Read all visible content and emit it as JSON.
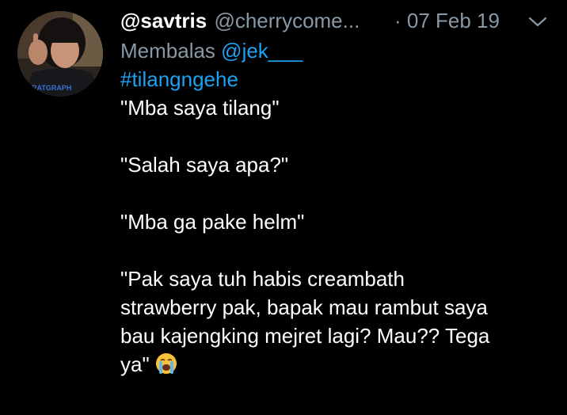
{
  "tweet": {
    "display_name": "@savtris",
    "handle": "@cherrycome...",
    "date": "· 07 Feb 19",
    "reply_prefix": "Membalas",
    "reply_mention": "@jek___",
    "hashtag": "#tilangngehe",
    "lines": [
      "\"Mba saya tilang\"",
      "",
      "\"Salah saya apa?\"",
      "",
      "\"Mba ga pake helm\"",
      "",
      "\"Pak saya tuh habis creambath",
      "strawberry pak, bapak mau rambut saya",
      "bau kajengking mejret lagi? Mau?? Tega",
      "ya\""
    ],
    "avatar_shirt_text": "RATGRAPH",
    "emoji_name": "loudly-crying-face-icon",
    "menu_icon": "chevron-down-icon"
  },
  "colors": {
    "background": "#000000",
    "text": "#ffffff",
    "secondary": "#8899a6",
    "link": "#1da1f2"
  }
}
